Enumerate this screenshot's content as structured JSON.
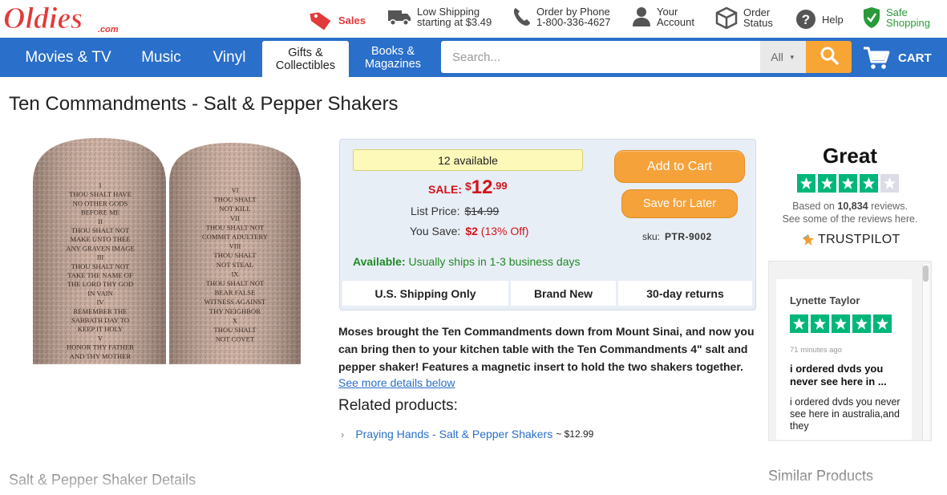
{
  "brand": {
    "logo_text": "Oldies",
    "logo_suffix": ".com"
  },
  "utility": {
    "sales": "Sales",
    "shipping_line1": "Low Shipping",
    "shipping_line2": "starting at $3.49",
    "phone_line1": "Order by Phone",
    "phone_line2": "1-800-336-4627",
    "account_line1": "Your",
    "account_line2": "Account",
    "status_line1": "Order",
    "status_line2": "Status",
    "help": "Help",
    "safe_line1": "Safe",
    "safe_line2": "Shopping"
  },
  "nav": {
    "movies": "Movies & TV",
    "music": "Music",
    "vinyl": "Vinyl",
    "gifts_line1": "Gifts &",
    "gifts_line2": "Collectibles",
    "books_line1": "Books &",
    "books_line2": "Magazines",
    "search_placeholder": "Search...",
    "search_scope": "All",
    "cart": "CART"
  },
  "product": {
    "title": "Ten Commandments - Salt & Pepper Shakers",
    "image_text": {
      "left": [
        "I",
        "THOU SHALT HAVE",
        "NO OTHER GODS",
        "BEFORE ME",
        "II",
        "THOU SHALT NOT",
        "MAKE UNTO THEE",
        "ANY GRAVEN IMAGE",
        "III",
        "THOU SHALT NOT",
        "TAKE THE NAME OF",
        "THE LORD THY GOD",
        "IN VAIN",
        "IV",
        "REMEMBER THE",
        "SABBATH DAY TO",
        "KEEP IT HOLY",
        "V",
        "HONOR THY FATHER",
        "AND THY MOTHER"
      ],
      "right": [
        "VI",
        "THOU SHALT",
        "NOT KILL",
        "VII",
        "THOU SHALT NOT",
        "COMMIT ADULTERY",
        "VIII",
        "THOU SHALT",
        "NOT STEAL",
        "IX",
        "THOU SHALT NOT",
        "BEAR FALSE",
        "WITNESS AGAINST",
        "THY NEIGHBOR",
        "X",
        "THOU SHALT",
        "NOT COVET"
      ]
    },
    "available_count": "12 available",
    "sale_label": "SALE:",
    "sale_currency": "$",
    "sale_dollars": "12",
    "sale_cents": ".99",
    "list_price_label": "List Price:",
    "list_price": "$14.99",
    "you_save_label": "You Save:",
    "you_save_amount": "$2",
    "you_save_pct": "(13% Off)",
    "add_to_cart": "Add to Cart",
    "save_for_later": "Save for Later",
    "sku_label": "sku:",
    "sku": "PTR-9002",
    "availability_label": "Available:",
    "availability_text": "Usually ships in 1-3 business days",
    "tiles": [
      "U.S. Shipping Only",
      "Brand New",
      "30-day returns"
    ],
    "description": "Moses brought the Ten Commandments down from Mount Sinai, and now you can bring then to your kitchen table with the Ten Commandments 4\" salt and pepper shaker! Features a magnetic insert to hold the two shakers together.",
    "see_more": "See more details below",
    "related_heading": "Related products:",
    "related": [
      {
        "name": "Praying Hands - Salt & Pepper Shakers",
        "price": "~ $12.99"
      }
    ],
    "details_heading": "Salt & Pepper Shaker Details"
  },
  "trustpilot": {
    "rating_word": "Great",
    "stars_filled": 4,
    "stars_total": 5,
    "based_prefix": "Based on",
    "review_count": "10,834",
    "based_suffix": "reviews.",
    "see_some": "See some of the reviews here.",
    "logo_text": "TRUSTPILOT",
    "colors": {
      "green": "#00b67a",
      "empty": "#dcdce6"
    },
    "review": {
      "author": "Lynette Taylor",
      "stars": 5,
      "time": "71 minutes ago",
      "headline": "i ordered dvds you never see here in ...",
      "body": "i ordered dvds you never see here in australia,and they"
    }
  },
  "similar_heading": "Similar Products",
  "colors": {
    "nav_blue": "#2a6fc9",
    "orange": "#f6a23a",
    "sale_red": "#d2141c",
    "avail_green": "#1f8a25"
  }
}
